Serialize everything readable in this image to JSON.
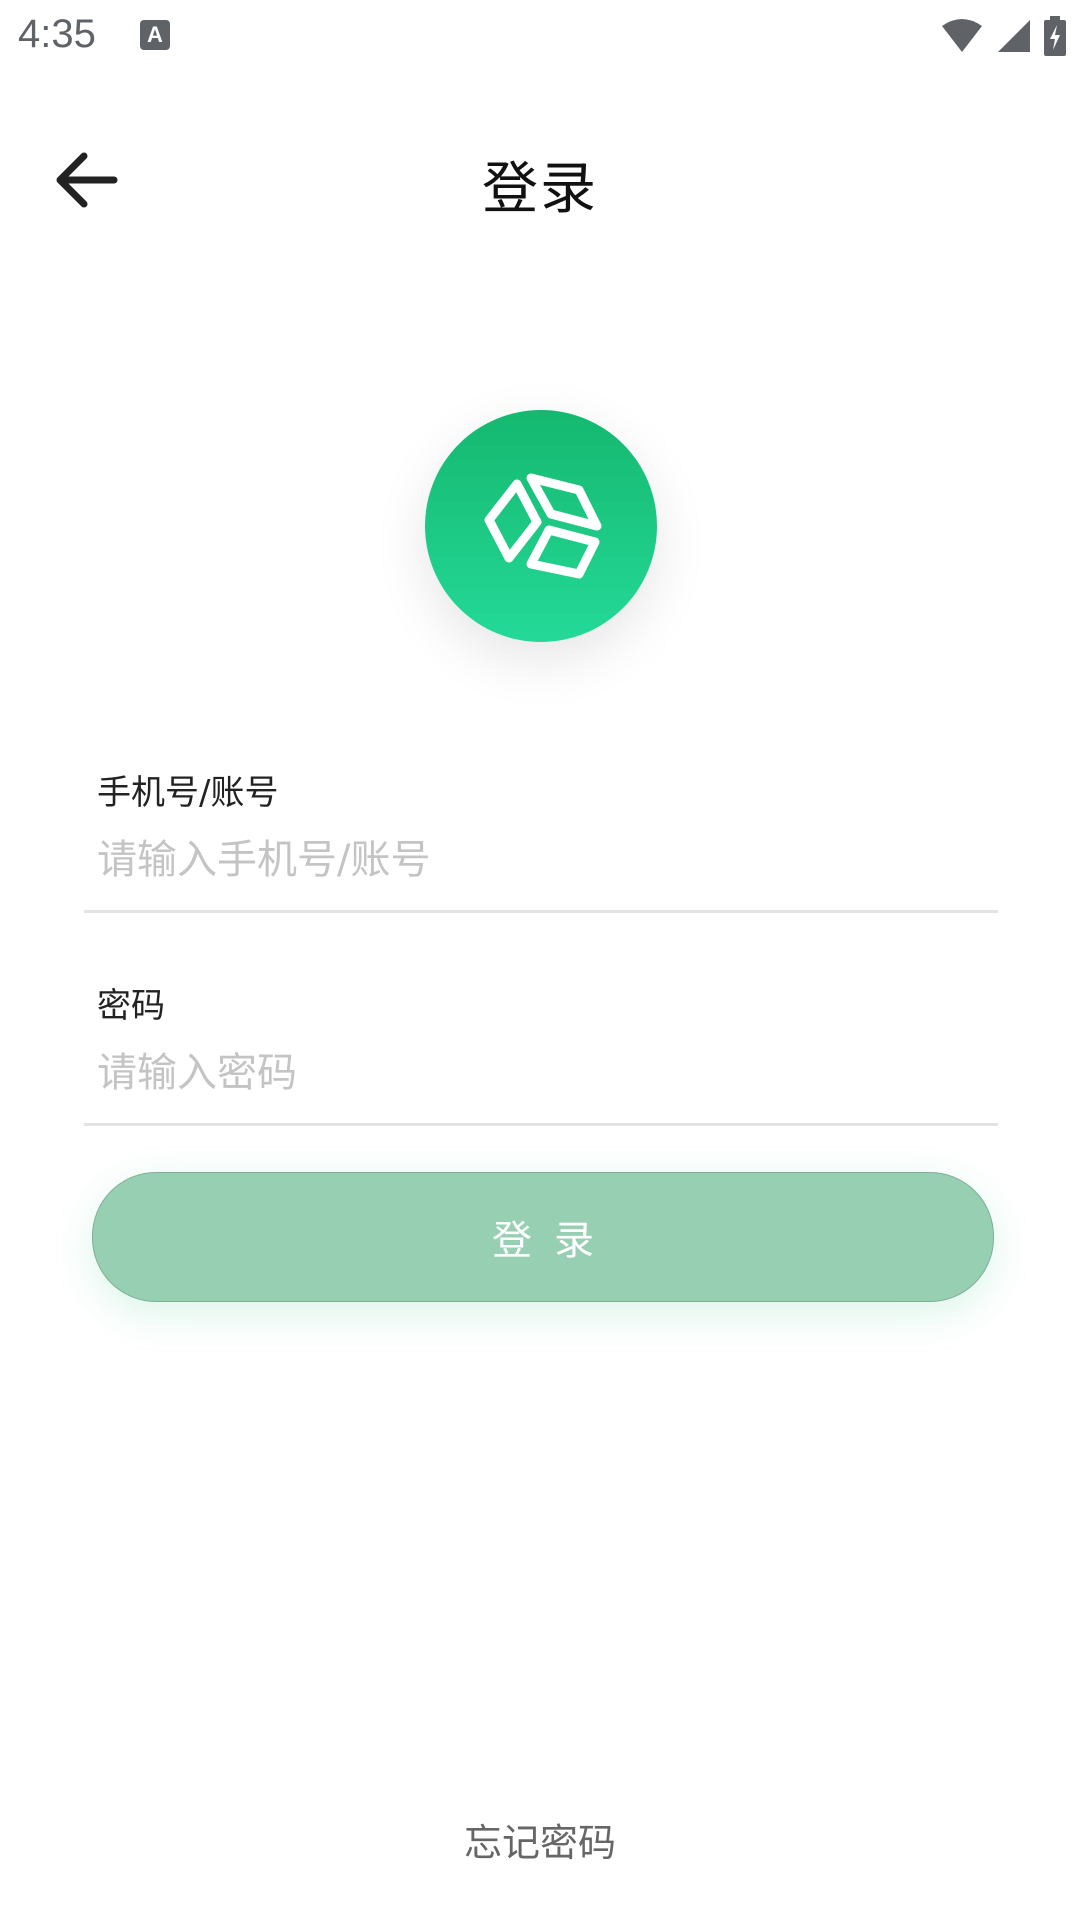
{
  "status_bar": {
    "time": "4:35",
    "notification_icon_letter": "A",
    "icons": [
      "wifi-icon",
      "signal-icon",
      "battery-charging-icon"
    ]
  },
  "app_bar": {
    "title": "登录",
    "back_icon": "arrow-left-icon"
  },
  "logo": {
    "icon": "cube-icon",
    "gradient_top": "#15b86f",
    "gradient_bottom": "#24d998"
  },
  "form": {
    "account": {
      "label": "手机号/账号",
      "placeholder": "请输入手机号/账号",
      "value": ""
    },
    "password": {
      "label": "密码",
      "placeholder": "请输入密码",
      "value": ""
    },
    "submit_label": "登录"
  },
  "footer": {
    "forgot_password": "忘记密码"
  },
  "colors": {
    "button_bg": "#97cfb3",
    "accent": "#1dc882"
  }
}
